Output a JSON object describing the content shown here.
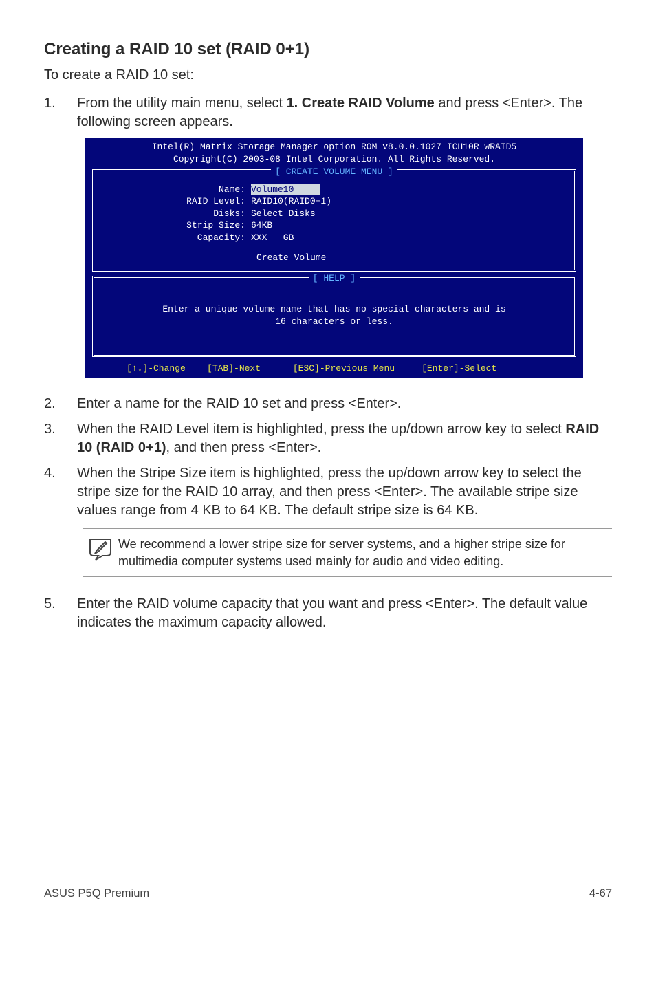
{
  "heading": "Creating a RAID 10 set (RAID 0+1)",
  "intro": "To create a RAID 10 set:",
  "steps": {
    "s1": {
      "num": "1.",
      "text_before": "From the utility main menu, select ",
      "bold": "1. Create RAID Volume",
      "text_after": " and press <Enter>. The following screen appears."
    },
    "s2": {
      "num": "2.",
      "text": "Enter a name for the RAID 10 set and press <Enter>."
    },
    "s3": {
      "num": "3.",
      "text_before": "When the RAID Level item is highlighted, press the up/down arrow key to select ",
      "bold": "RAID 10 (RAID 0+1)",
      "text_after": ", and then press <Enter>."
    },
    "s4": {
      "num": "4.",
      "text": "When the Stripe Size item is highlighted, press the up/down arrow key to select the stripe size for the RAID 10 array, and then press <Enter>. The available stripe size values range from 4 KB to 64 KB. The default stripe size is 64 KB."
    },
    "s5": {
      "num": "5.",
      "text": "Enter the RAID volume capacity that you want and press <Enter>. The default value indicates the maximum capacity allowed."
    }
  },
  "console": {
    "header_l1": "Intel(R) Matrix Storage Manager option ROM v8.0.0.1027 ICH10R wRAID5",
    "header_l2": "Copyright(C) 2003-08 Intel Corporation. All Rights Reserved.",
    "menu_title": "[ CREATE VOLUME MENU ]",
    "name_label": "Name:",
    "name_value": "Volume10",
    "raid_label": "RAID Level:",
    "raid_value": "RAID10(RAID0+1)",
    "disks_label": "Disks:",
    "disks_value": "Select Disks",
    "strip_label": "Strip Size:",
    "strip_value": "64KB",
    "capacity_label": "Capacity:",
    "capacity_value": "XXX   GB",
    "create_volume": "Create Volume",
    "help_title": "[ HELP ]",
    "help_line1": "Enter a unique volume name that has no special characters and is",
    "help_line2": "16 characters or less.",
    "footer": "[↑↓]-Change    [TAB]-Next      [ESC]-Previous Menu     [Enter]-Select"
  },
  "note": "We recommend a lower stripe size for server systems, and a higher stripe size for multimedia computer systems used mainly for audio and video editing.",
  "footer": {
    "left": "ASUS P5Q Premium",
    "right": "4-67"
  }
}
